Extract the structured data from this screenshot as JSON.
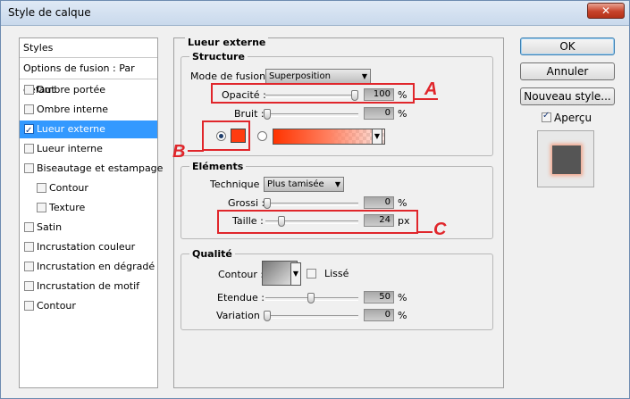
{
  "window": {
    "title": "Style de calque",
    "close_glyph": "✕"
  },
  "left_list": {
    "header": "Styles",
    "blend_options": "Options de fusion : Par défaut",
    "items": [
      {
        "label": "Ombre portée",
        "checked": false,
        "active": false
      },
      {
        "label": "Ombre interne",
        "checked": false,
        "active": false
      },
      {
        "label": "Lueur externe",
        "checked": true,
        "active": true
      },
      {
        "label": "Lueur interne",
        "checked": false,
        "active": false
      },
      {
        "label": "Biseautage et estampage",
        "checked": false,
        "active": false
      },
      {
        "label": "Contour",
        "checked": false,
        "active": false
      },
      {
        "label": "Texture",
        "checked": false,
        "active": false
      },
      {
        "label": "Satin",
        "checked": false,
        "active": false
      },
      {
        "label": "Incrustation couleur",
        "checked": false,
        "active": false
      },
      {
        "label": "Incrustation en dégradé",
        "checked": false,
        "active": false
      },
      {
        "label": "Incrustation de motif",
        "checked": false,
        "active": false
      },
      {
        "label": "Contour",
        "checked": false,
        "active": false
      }
    ]
  },
  "panel": {
    "title": "Lueur externe",
    "structure": {
      "legend": "Structure",
      "blend_mode_label": "Mode de fusion :",
      "blend_mode_value": "Superposition",
      "opacity_label": "Opacité :",
      "opacity_value": "100",
      "opacity_unit": "%",
      "noise_label": "Bruit :",
      "noise_value": "0",
      "noise_unit": "%",
      "glow_color": "#ff3c10"
    },
    "elements": {
      "legend": "Eléments",
      "technique_label": "Technique :",
      "technique_value": "Plus tamisée",
      "spread_label": "Grossi :",
      "spread_value": "0",
      "spread_unit": "%",
      "size_label": "Taille :",
      "size_value": "24",
      "size_unit": "px"
    },
    "quality": {
      "legend": "Qualité",
      "contour_label": "Contour :",
      "lisse_label": "Lissé",
      "range_label": "Etendue :",
      "range_value": "50",
      "range_unit": "%",
      "jitter_label": "Variation :",
      "jitter_value": "0",
      "jitter_unit": "%"
    }
  },
  "annotations": {
    "a": "A",
    "b": "B",
    "c": "C",
    "color": "#e0262b"
  },
  "buttons": {
    "ok": "OK",
    "cancel": "Annuler",
    "new_style": "Nouveau style...",
    "preview_label": "Aperçu",
    "preview_checked": true
  }
}
